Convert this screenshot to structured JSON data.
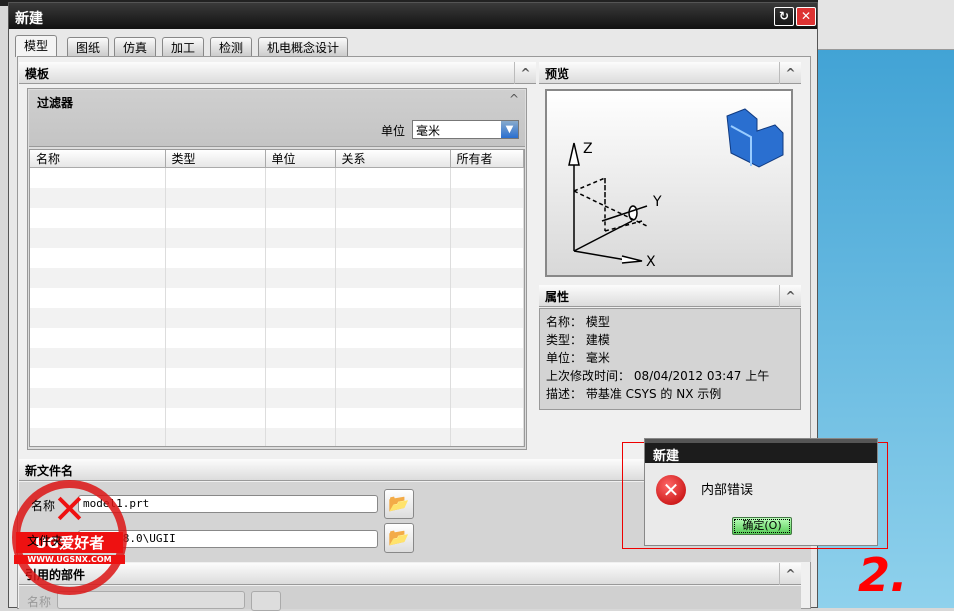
{
  "window": {
    "title": "新建"
  },
  "tabs": [
    "模型",
    "图纸",
    "仿真",
    "加工",
    "检测",
    "机电概念设计"
  ],
  "template": {
    "title": "模板",
    "filter": {
      "title": "过滤器",
      "unit_label": "单位",
      "unit_value": "毫米"
    },
    "columns": [
      "名称",
      "类型",
      "单位",
      "关系",
      "所有者"
    ]
  },
  "preview": {
    "title": "预览",
    "axes": [
      "Z",
      "Y",
      "X"
    ]
  },
  "properties": {
    "title": "属性",
    "rows": [
      {
        "k": "名称：",
        "v": "模型"
      },
      {
        "k": "类型：",
        "v": "建模"
      },
      {
        "k": "单位：",
        "v": "毫米"
      },
      {
        "k": "上次修改时间：",
        "v": "08/04/2012 03:47 上午"
      },
      {
        "k": "描述：",
        "v": "带基准 CSYS 的 NX 示例"
      }
    ]
  },
  "new_file": {
    "title": "新文件名",
    "name_label": "名称",
    "name_value": "model1.prt",
    "folder_label": "文件夹",
    "folder_value": "E:\\NX 8.0\\UGII"
  },
  "referenced": {
    "title": "引用的部件",
    "name_label": "名称"
  },
  "error_dialog": {
    "title": "新建",
    "message": "内部错误",
    "ok": "确定(O)"
  },
  "annotation": "2.",
  "watermark": {
    "text1": "UG爱好者",
    "text2": "WWW.UGSNX.COM"
  },
  "colors": {
    "error": "#d11",
    "accent": "#2a6fd0"
  }
}
